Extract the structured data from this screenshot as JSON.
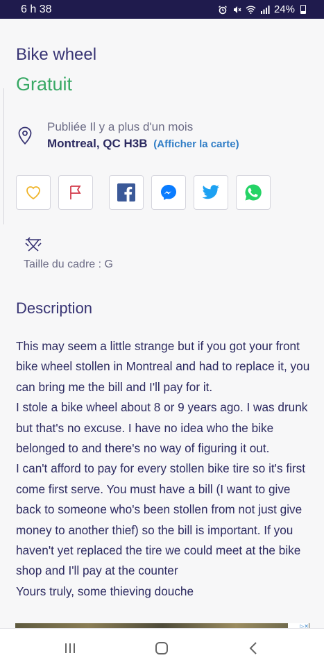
{
  "status_bar": {
    "time": "6 h 38",
    "battery": "24%",
    "icons": [
      "alarm-icon",
      "mute-icon",
      "wifi-icon",
      "signal-icon",
      "battery-icon"
    ]
  },
  "listing": {
    "title": "Bike wheel",
    "price": "Gratuit",
    "posted": "Publiée Il y a plus d'un mois",
    "location": "Montreal, QC H3B",
    "map_link": "(Afficher la carte)"
  },
  "actions": [
    {
      "name": "favorite",
      "icon": "heart-icon"
    },
    {
      "name": "report",
      "icon": "flag-icon"
    },
    {
      "name": "facebook",
      "icon": "facebook-icon"
    },
    {
      "name": "messenger",
      "icon": "messenger-icon"
    },
    {
      "name": "twitter",
      "icon": "twitter-icon"
    },
    {
      "name": "whatsapp",
      "icon": "whatsapp-icon"
    }
  ],
  "attributes": {
    "frame_size": "Taille du cadre : G"
  },
  "description": {
    "heading": "Description",
    "paragraphs": [
      "This may seem a little strange but if you got your front bike wheel stollen in Montreal and had to replace it, you can bring me the bill and I'll pay for it.",
      "I stole a bike wheel about 8 or 9 years ago. I was drunk but that's no excuse. I have no idea who the bike belonged to and there's no way of figuring it out.",
      "I can't afford to pay for every stollen bike tire so it's first come first serve. You must have a bill (I want to give back to someone who's been stollen from not just give money to another thief) so the bill is important. If you haven't yet replaced the tire we could meet at the bike shop and I'll pay at the counter",
      "Yours truly, some thieving douche"
    ]
  },
  "colors": {
    "status_bar_bg": "#1f1b4d",
    "price_green": "#37a864",
    "link_blue": "#2f7dc6",
    "heart": "#f0b429",
    "flag": "#d33b4b",
    "facebook": "#3b5998",
    "messenger": "#0a7cff",
    "twitter": "#1da1f2",
    "whatsapp": "#25d366"
  },
  "nav": [
    "recents-icon",
    "home-icon",
    "back-icon"
  ]
}
